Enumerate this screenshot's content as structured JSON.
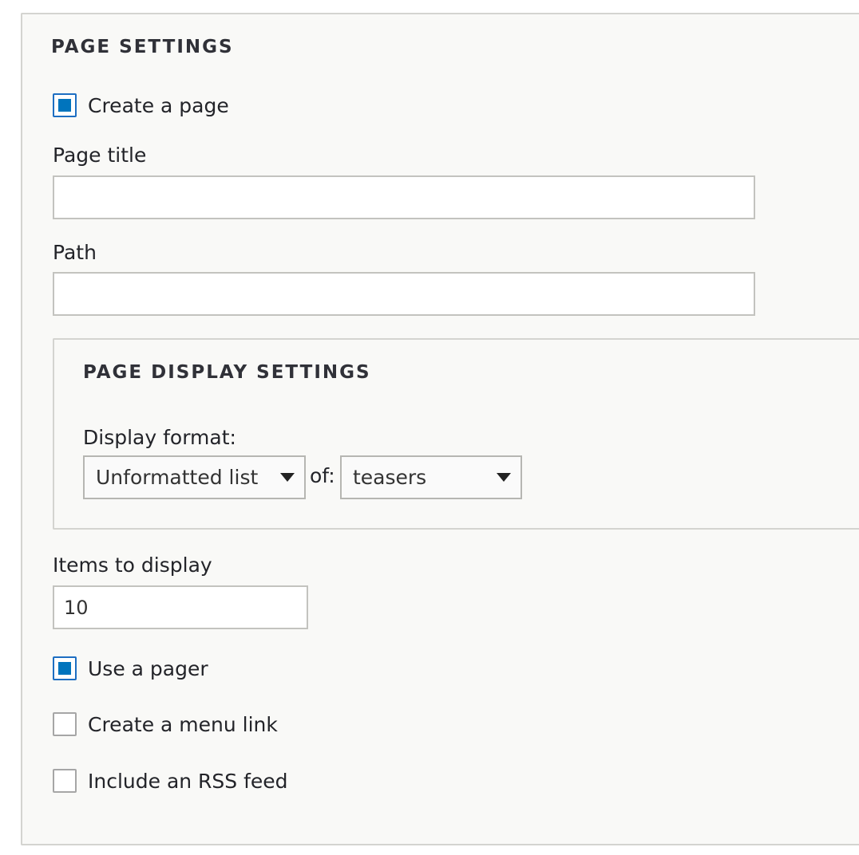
{
  "page_settings": {
    "legend": "PAGE SETTINGS",
    "create_page": {
      "label": "Create a page",
      "checked": true
    },
    "page_title": {
      "label": "Page title",
      "value": "",
      "placeholder": ""
    },
    "path": {
      "label": "Path",
      "value": "",
      "placeholder": ""
    },
    "display_settings": {
      "legend": "PAGE DISPLAY SETTINGS",
      "display_format_label": "Display format:",
      "format_select": {
        "value": "Unformatted list"
      },
      "of_label": "of:",
      "row_select": {
        "value": "teasers"
      }
    },
    "items_to_display": {
      "label": "Items to display",
      "value": "10"
    },
    "use_pager": {
      "label": "Use a pager",
      "checked": true
    },
    "menu_link": {
      "label": "Create a menu link",
      "checked": false
    },
    "rss_feed": {
      "label": "Include an RSS feed",
      "checked": false
    }
  },
  "colors": {
    "accent": "#0074bd",
    "panel_bg": "#f9f9f7",
    "border": "#d4d4d0"
  },
  "icons": {
    "select_caret": "caret-down-icon",
    "checkbox_mark": "check-square-icon"
  }
}
